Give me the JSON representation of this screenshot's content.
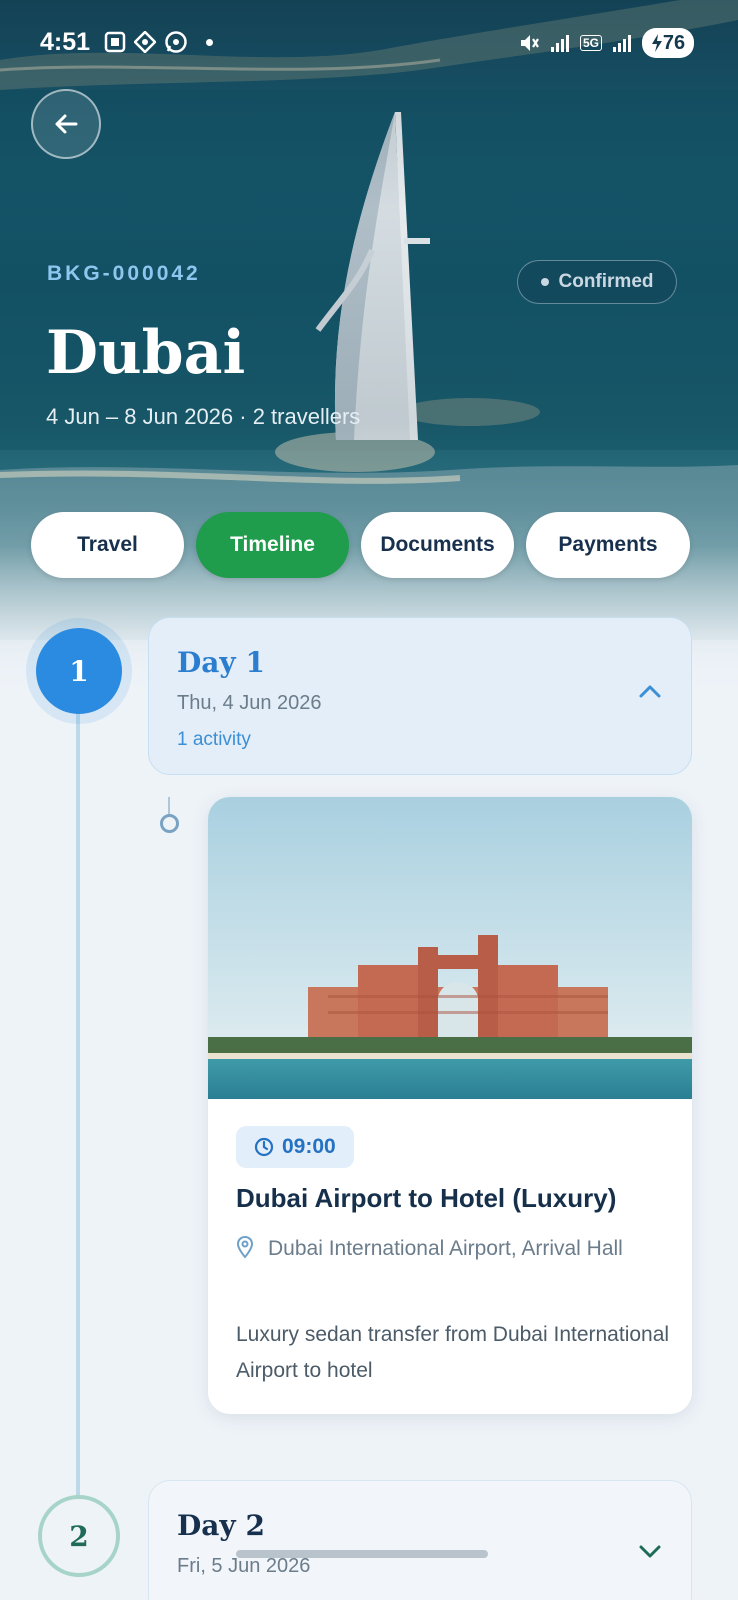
{
  "status_bar": {
    "time": "4:51",
    "battery": "76",
    "network_label": "5G"
  },
  "header": {
    "booking_id": "BKG-000042",
    "status": "Confirmed",
    "city": "Dubai",
    "trip_meta": "4 Jun – 8 Jun 2026 · 2 travellers"
  },
  "tabs": [
    {
      "label": "Travel",
      "active": false
    },
    {
      "label": "Timeline",
      "active": true
    },
    {
      "label": "Documents",
      "active": false
    },
    {
      "label": "Payments",
      "active": false
    }
  ],
  "timeline": {
    "days": [
      {
        "number": "1",
        "title": "Day 1",
        "date": "Thu, 4 Jun 2026",
        "activity_count": "1 activity",
        "expanded": true,
        "activities": [
          {
            "time": "09:00",
            "title": "Dubai Airport to Hotel (Luxury)",
            "location": "Dubai International Airport, Arrival Hall",
            "description": "Luxury sedan transfer from Dubai International Airport to hotel"
          }
        ]
      },
      {
        "number": "2",
        "title": "Day 2",
        "date": "Fri, 5 Jun 2026",
        "expanded": false
      }
    ]
  },
  "colors": {
    "accent_blue": "#2b8be0",
    "tab_active_green": "#1f9d4d",
    "page_background": "#eef3f8"
  },
  "icons": {
    "back": "arrow-left-icon",
    "clock": "clock-icon",
    "location": "map-pin-icon",
    "expand": "chevron-up-icon",
    "collapse": "chevron-down-icon"
  }
}
